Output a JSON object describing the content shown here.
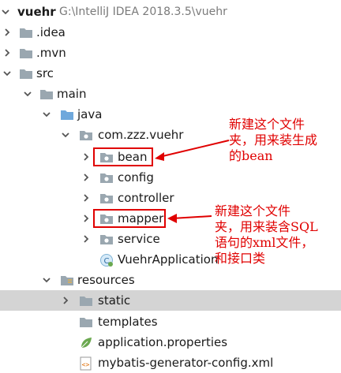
{
  "project": {
    "name": "vuehr",
    "path": "G:\\IntelliJ IDEA 2018.3.5\\vuehr"
  },
  "tree": {
    "idea": ".idea",
    "mvn": ".mvn",
    "src": "src",
    "main": "main",
    "java": "java",
    "package": "com.zzz.vuehr",
    "bean": "bean",
    "config": "config",
    "controller": "controller",
    "mapper": "mapper",
    "service": "service",
    "app_class": "VuehrApplication",
    "resources": "resources",
    "static": "static",
    "templates": "templates",
    "app_properties": "application.properties",
    "mybatis_config": "mybatis-generator-config.xml"
  },
  "annotations": {
    "bean_note": "新建这个文件\n夹，用来装生成\n的bean",
    "mapper_note": "新建这个文件\n夹，用来装含SQL\n语句的xml文件，\n和接口类"
  },
  "colors": {
    "annotation": "#e00000",
    "folder": "#9aa7b0",
    "source_folder": "#6fa8dc",
    "selected_row": "#d4d4d4"
  }
}
